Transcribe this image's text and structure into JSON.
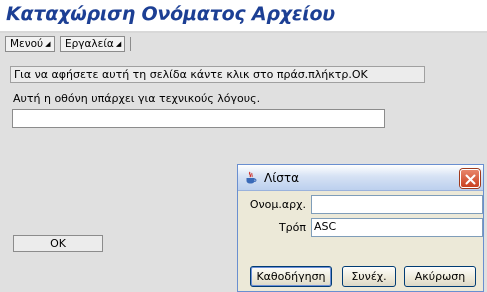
{
  "header": {
    "title": "Καταχώριση Ονόματος Αρχείου"
  },
  "menubar": {
    "items": [
      {
        "label": "Μενού",
        "icon": "dropdown-arrow-icon"
      },
      {
        "label": "Εργαλεία",
        "icon": "dropdown-arrow-icon"
      }
    ]
  },
  "main": {
    "info_message": "Για να αφήσετε αυτή τη σελίδα κάντε κλικ στο πράσ.πλήκτρ.OK",
    "note": "Αυτή η οθόνη υπάρχει για τεχνικούς λόγους.",
    "input_value": "",
    "ok_label": "OK"
  },
  "dialog": {
    "title": "Λίστα",
    "icon": "java-cup-icon",
    "close_icon": "close-icon",
    "fields": [
      {
        "label": "Ονομ.αρχ.",
        "value": ""
      },
      {
        "label": "Τρόπ",
        "value": "ASC"
      }
    ],
    "buttons": {
      "navigate": "Καθοδήγηση",
      "continue": "Συνέχ.",
      "cancel": "Ακύρωση"
    }
  },
  "colors": {
    "title_text": "#1c3f94",
    "background": "#e0e0e0",
    "dialog_background": "#ece9d8",
    "close_button": "#c9401f"
  }
}
